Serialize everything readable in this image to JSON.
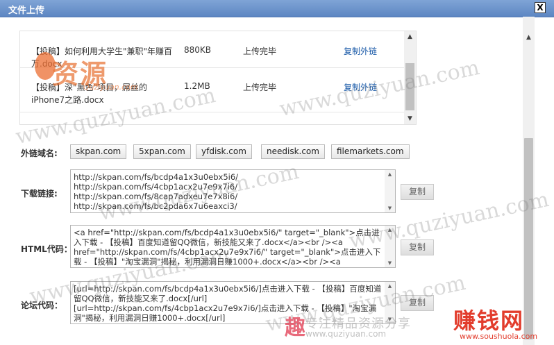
{
  "dialog": {
    "title": "文件上传",
    "close_label": "X"
  },
  "files": [
    {
      "name": "【投稿】如何利用大学生\"兼职\"年赚百万.docx",
      "size": "880KB",
      "status": "上传完毕",
      "link": "复制外链"
    },
    {
      "name": "【投稿】深\"黑色\"项目，屌丝的iPhone7之路.docx",
      "size": "1.2MB",
      "status": "上传完毕",
      "link": "复制外链"
    }
  ],
  "domains": {
    "label": "外链域名:",
    "items": [
      "skpan.com",
      "5xpan.com",
      "yfdisk.com",
      "needisk.com",
      "filemarkets.com"
    ]
  },
  "download": {
    "label": "下载链接:",
    "lines": [
      "http://skpan.com/fs/bcdp4a1x3u0ebx5i6/",
      "http://skpan.com/fs/4cbp1acx2u7e9x7i6/",
      "http://skpan.com/fs/8cap7adxeu7e7x8i6/",
      "http://skpan.com/fs/bc2pda6x7u6eaxci3/"
    ],
    "copy_label": "复制"
  },
  "html_code": {
    "label": "HTML代码：",
    "text": "<a href=\"http://skpan.com/fs/bcdp4a1x3u0ebx5i6/\" target=\"_blank\">点击进入下载 - 【投稿】百度知道留QQ微信，新技能又来了.docx</a><br /><a href=\"http://skpan.com/fs/4cbp1acx2u7e9x7i6/\" target=\"_blank\">点击进入下载 - 【投稿】\"淘宝漏洞\"揭秘，利用漏洞日赚1000+.docx</a><br /><a",
    "copy_label": "复制"
  },
  "forum_code": {
    "label": "论坛代码：",
    "text": "[url=http://skpan.com/fs/bcdp4a1x3u0ebx5i6/]点击进入下载 - 【投稿】百度知道留QQ微信，新技能又来了.docx[/url] [url=http://skpan.com/fs/4cbp1acx2u7e9x7i6/]点击进入下载 - 【投稿】\"淘宝漏洞\"揭秘，利用漏洞日赚1000+.docx[/url]",
    "copy_label": "复制"
  },
  "watermarks": {
    "url": "www.quziyuan.com",
    "logo": "资源",
    "logo_sub": "Quziyuan.com",
    "tagline": "专注精品资源分享",
    "tagline_url": "www.quziyuan.com",
    "tagline_icon": "趣",
    "corner": "赚钱网",
    "corner_url": "www.soushuola.com"
  }
}
